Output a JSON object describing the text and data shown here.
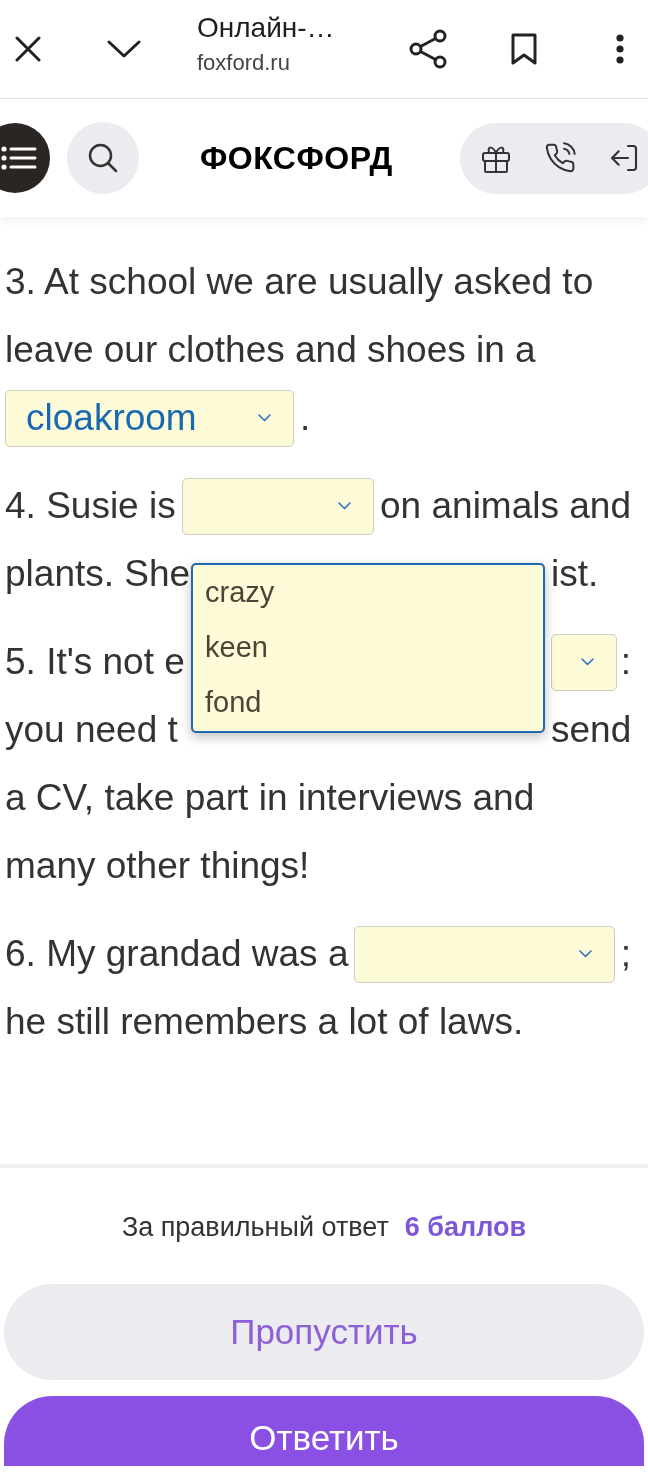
{
  "browser_bar": {
    "title": "Онлайн-…",
    "url": "foxford.ru"
  },
  "site_header": {
    "logo": "ФОКСФОРД"
  },
  "exercise": {
    "questions": [
      {
        "lines": [
          {
            "parts": [
              {
                "kind": "text",
                "text": "3. At school we are usually asked to"
              }
            ]
          },
          {
            "parts": [
              {
                "kind": "text",
                "text": "leave our clothes and shoes in a"
              }
            ]
          },
          {
            "parts": [
              {
                "kind": "select",
                "value": "cloakroom"
              },
              {
                "kind": "text",
                "text": "."
              }
            ]
          }
        ]
      },
      {
        "lines": [
          {
            "parts": [
              {
                "kind": "text",
                "text": "4. Susie is"
              },
              {
                "kind": "select",
                "options": [
                  {
                    "label": "crazy",
                    "selected": false
                  },
                  {
                    "label": "keen",
                    "selected": false
                  },
                  {
                    "label": "fond",
                    "selected": false
                  }
                ]
              },
              {
                "kind": "text",
                "text": "on animals and"
              }
            ]
          },
          {
            "parts": [
              {
                "kind": "text",
                "text": "plants. She"
              }
            ],
            "after_menu": [
              {
                "kind": "text",
                "text": "ist."
              }
            ]
          }
        ]
      },
      {
        "lines": [
          {
            "parts": [
              {
                "kind": "text",
                "text": "5. It's not e"
              }
            ],
            "after_menu": [
              {
                "kind": "select"
              },
              {
                "kind": "text",
                "text": ":"
              }
            ]
          },
          {
            "parts": [
              {
                "kind": "text",
                "text": "you need t"
              }
            ],
            "after_menu": [
              {
                "kind": "text",
                "text": "send"
              }
            ]
          },
          {
            "parts": [
              {
                "kind": "text",
                "text": "a CV, take part in interviews and"
              }
            ]
          },
          {
            "parts": [
              {
                "kind": "text",
                "text": "many other things!"
              }
            ]
          }
        ]
      },
      {
        "lines": [
          {
            "parts": [
              {
                "kind": "text",
                "text": "6. My grandad was a"
              },
              {
                "kind": "select"
              },
              {
                "kind": "text",
                "text": ";"
              }
            ]
          },
          {
            "parts": [
              {
                "kind": "text",
                "text": "he still remembers a lot of laws."
              }
            ]
          }
        ]
      }
    ]
  },
  "footer": {
    "reward_label": "За правильный ответ",
    "reward_points": "6 баллов",
    "buttons": [
      {
        "label": "Пропустить",
        "kind": "secondary"
      },
      {
        "label": "Ответить",
        "kind": "primary"
      }
    ]
  }
}
